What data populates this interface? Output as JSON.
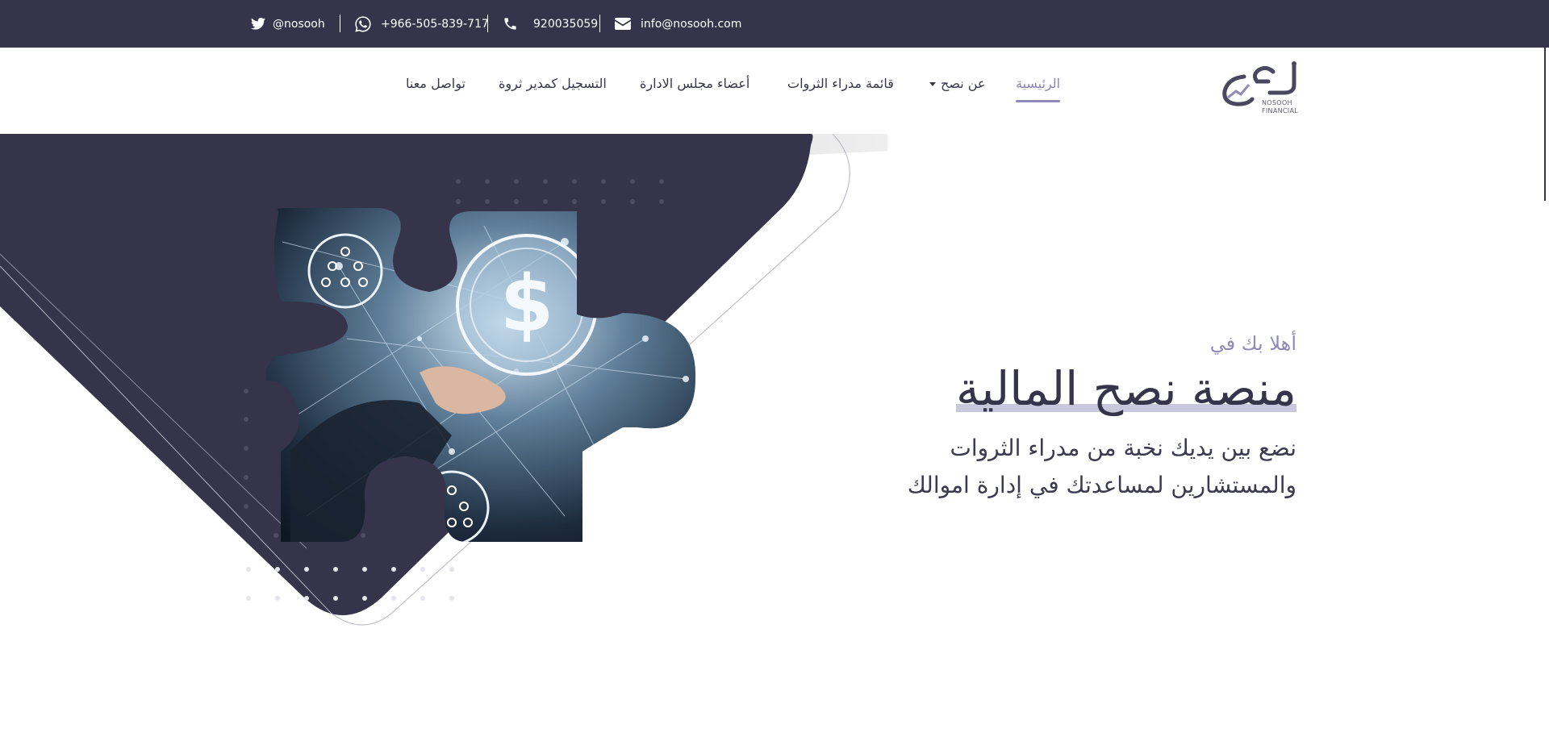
{
  "topbar": {
    "twitter": "@nosooh",
    "whatsapp": "+966-505-839-717",
    "phone": "920035059",
    "email": "info@nosooh.com"
  },
  "logo": {
    "name_ar": "نصح",
    "name_en_1": "NOSOOH",
    "name_en_2": "FINANCIAL"
  },
  "nav": {
    "home": "الرئيسية",
    "about": "عن نصح",
    "wealth_managers": "قائمة مدراء الثروات",
    "board": "أعضاء مجلس الادارة",
    "register": "التسجيل كمدير ثروة",
    "contact": "تواصل معنا"
  },
  "hero": {
    "welcome": "أهلا بك في",
    "title": "منصة نصح المالية",
    "subtitle_line1": "نضع بين يديك نخبة من مدراء الثروات",
    "subtitle_line2": "والمستشارين لمساعدتك في إدارة اموالك"
  },
  "colors": {
    "primary_dark": "#35344a",
    "accent_lavender": "#8f8bb8",
    "highlight": "#c9c7dc"
  },
  "icons": [
    "twitter-icon",
    "whatsapp-icon",
    "phone-icon",
    "mail-icon",
    "dollar-icon",
    "people-icon",
    "chevron-down-icon"
  ]
}
